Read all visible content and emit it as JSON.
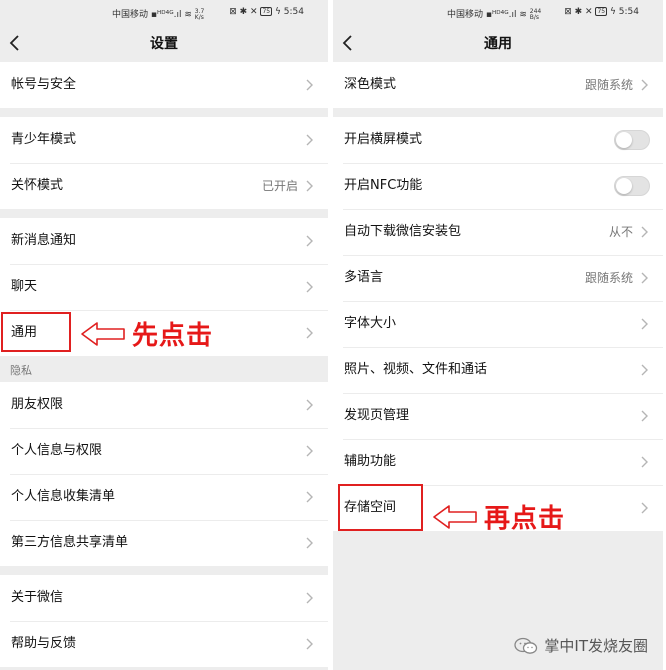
{
  "status_bar": {
    "carrier": "中国移动",
    "net_speed_left": [
      "3.7",
      "K/s"
    ],
    "net_speed_right": [
      "244",
      "B/s"
    ],
    "battery": "75",
    "time": "5:54"
  },
  "left": {
    "title": "设置",
    "group1": [
      {
        "label": "帐号与安全"
      }
    ],
    "group2": [
      {
        "label": "青少年模式"
      },
      {
        "label": "关怀模式",
        "value": "已开启"
      }
    ],
    "group3": [
      {
        "label": "新消息通知"
      },
      {
        "label": "聊天"
      },
      {
        "label": "通用"
      }
    ],
    "privacy_label": "隐私",
    "group4": [
      {
        "label": "朋友权限"
      },
      {
        "label": "个人信息与权限"
      },
      {
        "label": "个人信息收集清单"
      },
      {
        "label": "第三方信息共享清单"
      }
    ],
    "group5": [
      {
        "label": "关于微信"
      },
      {
        "label": "帮助与反馈"
      }
    ],
    "annotation": "先点击"
  },
  "right": {
    "title": "通用",
    "group1": [
      {
        "label": "深色模式",
        "value": "跟随系统"
      }
    ],
    "group2": [
      {
        "label": "开启横屏模式",
        "toggle": false
      },
      {
        "label": "开启NFC功能",
        "toggle": false
      },
      {
        "label": "自动下载微信安装包",
        "value": "从不"
      },
      {
        "label": "多语言",
        "value": "跟随系统"
      },
      {
        "label": "字体大小"
      },
      {
        "label": "照片、视频、文件和通话"
      },
      {
        "label": "发现页管理"
      },
      {
        "label": "辅助功能"
      },
      {
        "label": "存储空间"
      }
    ],
    "annotation": "再点击"
  },
  "watermark": "掌中IT发烧友圈",
  "colors": {
    "annotation": "#e61818",
    "page_bg": "#ededed"
  }
}
